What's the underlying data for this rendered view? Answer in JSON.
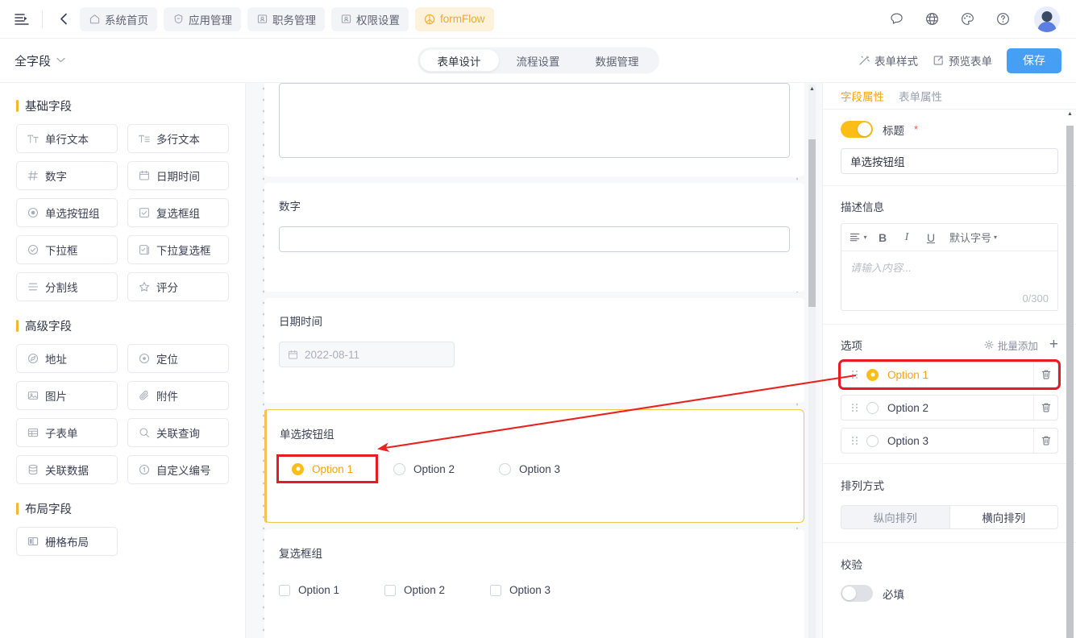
{
  "topbar": {
    "collapse_icon": "sidebar-collapse-icon",
    "back_icon": "chevron-left-icon",
    "nav_tabs": [
      {
        "label": "系统首页",
        "icon": "home-icon",
        "active": false
      },
      {
        "label": "应用管理",
        "icon": "apps-icon",
        "active": false
      },
      {
        "label": "职务管理",
        "icon": "id-card-icon",
        "active": false
      },
      {
        "label": "权限设置",
        "icon": "id-card-icon",
        "active": false
      },
      {
        "label": "formFlow",
        "icon": "flow-icon",
        "active": true
      }
    ],
    "right_icons": [
      "message-icon",
      "globe-icon",
      "palette-icon",
      "help-icon"
    ],
    "avatar": "user-avatar"
  },
  "subbar": {
    "field_selector": "全字段",
    "tabs": [
      {
        "label": "表单设计",
        "active": true
      },
      {
        "label": "流程设置",
        "active": false
      },
      {
        "label": "数据管理",
        "active": false
      }
    ],
    "form_style": "表单样式",
    "preview": "预览表单",
    "save": "保存"
  },
  "palette": {
    "groups": [
      {
        "title": "基础字段",
        "items": [
          {
            "label": "单行文本",
            "icon": "text-icon"
          },
          {
            "label": "多行文本",
            "icon": "textarea-icon"
          },
          {
            "label": "数字",
            "icon": "hash-icon"
          },
          {
            "label": "日期时间",
            "icon": "calendar-icon"
          },
          {
            "label": "单选按钮组",
            "icon": "radio-icon"
          },
          {
            "label": "复选框组",
            "icon": "checkbox-icon"
          },
          {
            "label": "下拉框",
            "icon": "select-icon"
          },
          {
            "label": "下拉复选框",
            "icon": "multiselect-icon"
          },
          {
            "label": "分割线",
            "icon": "divider-icon"
          },
          {
            "label": "评分",
            "icon": "star-icon"
          }
        ]
      },
      {
        "title": "高级字段",
        "items": [
          {
            "label": "地址",
            "icon": "address-icon"
          },
          {
            "label": "定位",
            "icon": "location-icon"
          },
          {
            "label": "图片",
            "icon": "image-icon"
          },
          {
            "label": "附件",
            "icon": "attachment-icon"
          },
          {
            "label": "子表单",
            "icon": "subform-icon"
          },
          {
            "label": "关联查询",
            "icon": "search-icon"
          },
          {
            "label": "关联数据",
            "icon": "database-icon"
          },
          {
            "label": "自定义编号",
            "icon": "number-circle-icon"
          }
        ]
      },
      {
        "title": "布局字段",
        "items": [
          {
            "label": "栅格布局",
            "icon": "grid-icon"
          }
        ]
      }
    ]
  },
  "canvas": {
    "fields": [
      {
        "type": "textarea",
        "label": "",
        "value": ""
      },
      {
        "type": "number",
        "label": "数字",
        "value": ""
      },
      {
        "type": "date",
        "label": "日期时间",
        "placeholder": "2022-08-11",
        "icon": "calendar-icon"
      },
      {
        "type": "radio-group",
        "label": "单选按钮组",
        "selected": true,
        "options": [
          "Option 1",
          "Option 2",
          "Option 3"
        ],
        "checked_index": 0
      },
      {
        "type": "checkbox-group",
        "label": "复选框组",
        "options": [
          "Option 1",
          "Option 2",
          "Option 3"
        ]
      }
    ]
  },
  "properties": {
    "tabs": [
      {
        "label": "字段属性",
        "active": true
      },
      {
        "label": "表单属性",
        "active": false
      }
    ],
    "title_toggle_on": true,
    "title_label": "标题",
    "title_required_mark": "*",
    "title_value": "单选按钮组",
    "description_label": "描述信息",
    "editor": {
      "align_icon": "align-left-icon",
      "bold": "B",
      "italic": "I",
      "underline": "U",
      "font_size": "默认字号",
      "placeholder": "请输入内容...",
      "counter": "0/300"
    },
    "options_label": "选项",
    "batch_add": "批量添加",
    "add_icon": "plus-icon",
    "options": [
      {
        "label": "Option 1",
        "checked": true,
        "highlighted": true
      },
      {
        "label": "Option 2",
        "checked": false,
        "highlighted": false
      },
      {
        "label": "Option 3",
        "checked": false,
        "highlighted": false
      }
    ],
    "delete_icon": "trash-icon",
    "layout_label": "排列方式",
    "layout_options": [
      {
        "label": "纵向排列",
        "active": true
      },
      {
        "label": "横向排列",
        "active": false
      }
    ],
    "validation_label": "校验",
    "required_toggle_on": false,
    "required_label": "必填"
  },
  "colors": {
    "accent_yellow": "#fbbd16",
    "accent_orange": "#f3a418",
    "primary_blue": "#479ef5",
    "annotation_red": "#e81b23",
    "required_red": "#f5564a"
  }
}
